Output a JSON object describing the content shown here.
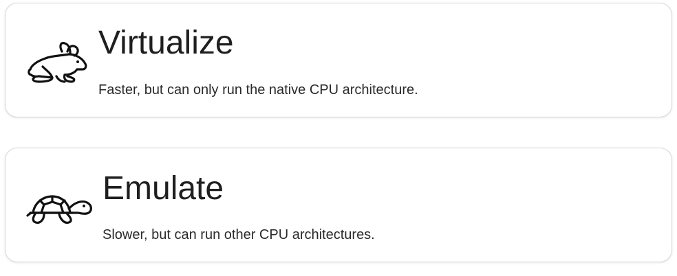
{
  "options": [
    {
      "id": "virtualize",
      "title": "Virtualize",
      "description": "Faster, but can only run the native CPU architecture.",
      "icon": "rabbit-icon"
    },
    {
      "id": "emulate",
      "title": "Emulate",
      "description": "Slower, but can run other CPU architectures.",
      "icon": "turtle-icon"
    }
  ],
  "colors": {
    "card_border": "#d9d9d9",
    "text": "#1f1f1f",
    "background": "#ffffff"
  }
}
